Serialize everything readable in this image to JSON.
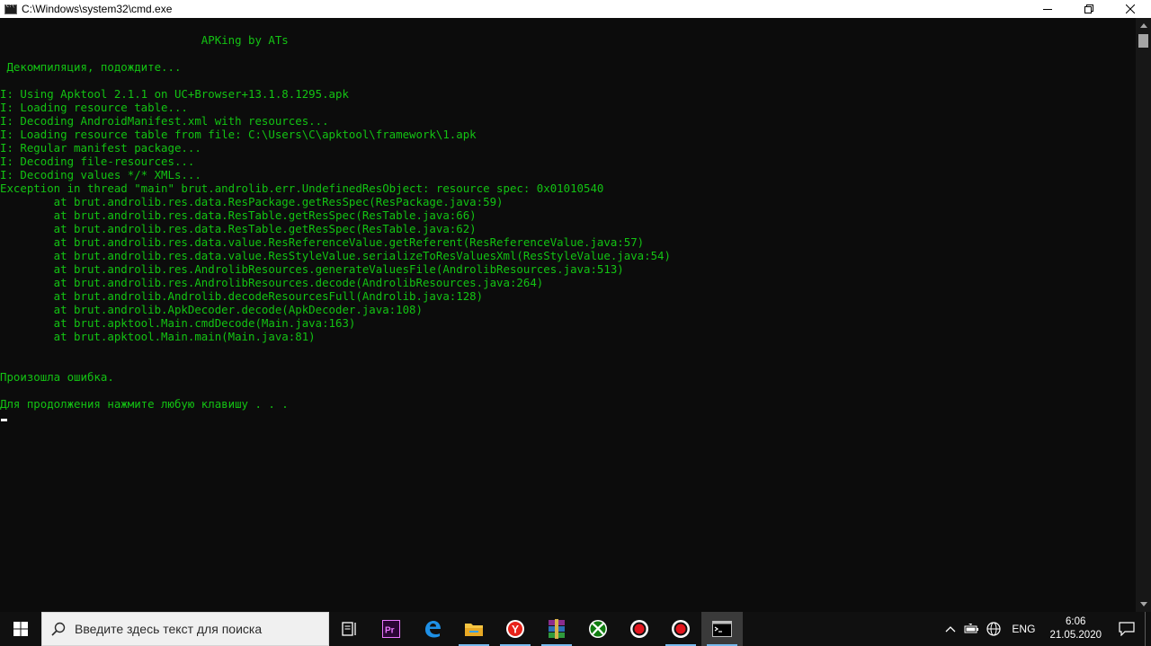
{
  "window": {
    "title": "C:\\Windows\\system32\\cmd.exe"
  },
  "console": {
    "lines": [
      {
        "text": "                              APKing by ATs",
        "row": 1
      },
      {
        "text": " Декомпиляция, подождите...",
        "row": 3
      },
      {
        "text": "I: Using Apktool 2.1.1 on UC+Browser+13.1.8.1295.apk",
        "row": 5
      },
      {
        "text": "I: Loading resource table...",
        "row": 6
      },
      {
        "text": "I: Decoding AndroidManifest.xml with resources...",
        "row": 7
      },
      {
        "text": "I: Loading resource table from file: C:\\Users\\C\\apktool\\framework\\1.apk",
        "row": 8
      },
      {
        "text": "I: Regular manifest package...",
        "row": 9
      },
      {
        "text": "I: Decoding file-resources...",
        "row": 10
      },
      {
        "text": "I: Decoding values */* XMLs...",
        "row": 11
      },
      {
        "text": "Exception in thread \"main\" brut.androlib.err.UndefinedResObject: resource spec: 0x01010540",
        "row": 12
      },
      {
        "text": "        at brut.androlib.res.data.ResPackage.getResSpec(ResPackage.java:59)",
        "row": 13
      },
      {
        "text": "        at brut.androlib.res.data.ResTable.getResSpec(ResTable.java:66)",
        "row": 14
      },
      {
        "text": "        at brut.androlib.res.data.ResTable.getResSpec(ResTable.java:62)",
        "row": 15
      },
      {
        "text": "        at brut.androlib.res.data.value.ResReferenceValue.getReferent(ResReferenceValue.java:57)",
        "row": 16
      },
      {
        "text": "        at brut.androlib.res.data.value.ResStyleValue.serializeToResValuesXml(ResStyleValue.java:54)",
        "row": 17
      },
      {
        "text": "        at brut.androlib.res.AndrolibResources.generateValuesFile(AndrolibResources.java:513)",
        "row": 18
      },
      {
        "text": "        at brut.androlib.res.AndrolibResources.decode(AndrolibResources.java:264)",
        "row": 19
      },
      {
        "text": "        at brut.androlib.Androlib.decodeResourcesFull(Androlib.java:128)",
        "row": 20
      },
      {
        "text": "        at brut.androlib.ApkDecoder.decode(ApkDecoder.java:108)",
        "row": 21
      },
      {
        "text": "        at brut.apktool.Main.cmdDecode(Main.java:163)",
        "row": 22
      },
      {
        "text": "        at brut.apktool.Main.main(Main.java:81)",
        "row": 23
      },
      {
        "text": "Произошла ошибка.",
        "row": 26
      },
      {
        "text": "Для продолжения нажмите любую клавишу . . .",
        "row": 28
      }
    ],
    "text_color": "#13c313"
  },
  "taskbar": {
    "search_placeholder": "Введите здесь текст для поиска",
    "apps": [
      {
        "name": "task-view-icon"
      },
      {
        "name": "premiere-pro-icon",
        "label": "Pr"
      },
      {
        "name": "edge-icon"
      },
      {
        "name": "file-explorer-icon"
      },
      {
        "name": "yandex-browser-icon",
        "label": "Y"
      },
      {
        "name": "winrar-icon"
      },
      {
        "name": "xbox-icon"
      },
      {
        "name": "screen-recorder-icon"
      },
      {
        "name": "record-icon"
      },
      {
        "name": "cmd-icon"
      }
    ],
    "tray": {
      "language": "ENG",
      "time": "6:06",
      "date": "21.05.2020"
    }
  }
}
